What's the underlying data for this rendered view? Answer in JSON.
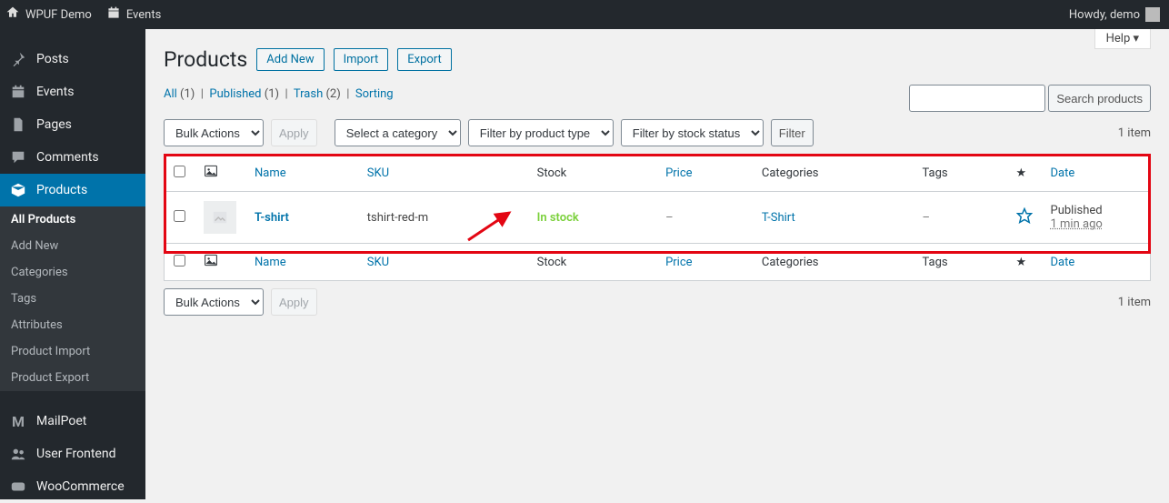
{
  "adminbar": {
    "site": "WPUF Demo",
    "events": "Events",
    "howdy": "Howdy, demo"
  },
  "sidebar": {
    "posts": "Posts",
    "events": "Events",
    "pages": "Pages",
    "comments": "Comments",
    "products": "Products",
    "submenu": {
      "all": "All Products",
      "add": "Add New",
      "categories": "Categories",
      "tags": "Tags",
      "attributes": "Attributes",
      "import": "Product Import",
      "export": "Product Export"
    },
    "mailpoet": "MailPoet",
    "user_frontend": "User Frontend",
    "woocommerce": "WooCommerce"
  },
  "screen": {
    "help": "Help ▾",
    "title": "Products",
    "actions": {
      "add": "Add New",
      "import": "Import",
      "export": "Export"
    },
    "filters": {
      "all_label": "All",
      "all_count": "(1)",
      "published_label": "Published",
      "published_count": "(1)",
      "trash_label": "Trash",
      "trash_count": "(2)",
      "sorting": "Sorting"
    },
    "search_button": "Search products",
    "bulk_actions": "Bulk Actions",
    "apply": "Apply",
    "select_category": "Select a category",
    "filter_product_type": "Filter by product type",
    "filter_stock": "Filter by stock status",
    "filter_btn": "Filter",
    "item_count": "1 item"
  },
  "table": {
    "cols": {
      "name": "Name",
      "sku": "SKU",
      "stock": "Stock",
      "price": "Price",
      "categories": "Categories",
      "tags": "Tags",
      "date": "Date"
    },
    "rows": [
      {
        "name": "T-shirt",
        "sku": "tshirt-red-m",
        "stock": "In stock",
        "price": "–",
        "categories": "T-Shirt",
        "tags": "–",
        "date_status": "Published",
        "date_time": "1 min ago"
      }
    ]
  }
}
